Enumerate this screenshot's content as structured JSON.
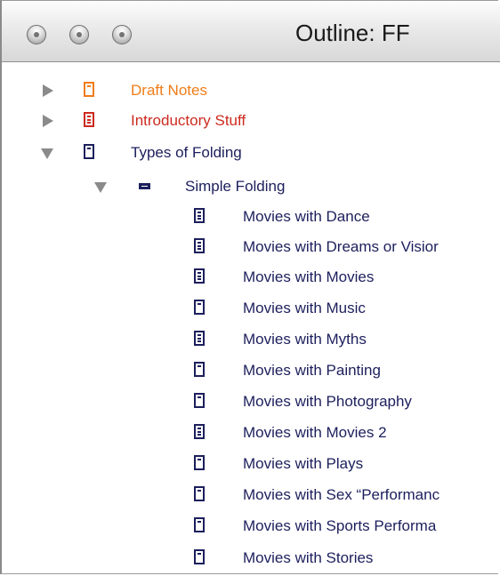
{
  "window": {
    "title": "Outline: FF",
    "controls": [
      "close",
      "minimize",
      "zoom"
    ]
  },
  "colors": {
    "orange": "#f07c18",
    "red": "#cc2b1f",
    "navy": "#1c1f5c",
    "disclosure": "#8a8a8a"
  },
  "outline": {
    "items": [
      {
        "label": "Draft Notes",
        "expanded": false,
        "color": "orange",
        "icon": "document-blank-icon"
      },
      {
        "label": "Introductory Stuff",
        "expanded": false,
        "color": "red",
        "icon": "document-lined-icon"
      },
      {
        "label": "Types of Folding",
        "expanded": true,
        "color": "navy",
        "icon": "document-blank-icon"
      },
      {
        "label": "Simple Folding",
        "expanded": true,
        "color": "navy",
        "icon": "folder-collapsed-icon"
      },
      {
        "label": "Movies with Dance",
        "color": "navy",
        "icon": "document-lined-icon"
      },
      {
        "label": "Movies with Dreams or Visior",
        "color": "navy",
        "icon": "document-lined-icon"
      },
      {
        "label": "Movies with Movies",
        "color": "navy",
        "icon": "document-lined-icon"
      },
      {
        "label": "Movies with Music",
        "color": "navy",
        "icon": "document-blank-icon"
      },
      {
        "label": "Movies with Myths",
        "color": "navy",
        "icon": "document-lined-icon"
      },
      {
        "label": "Movies with Painting",
        "color": "navy",
        "icon": "document-blank-icon"
      },
      {
        "label": "Movies with Photography",
        "color": "navy",
        "icon": "document-blank-icon"
      },
      {
        "label": "Movies with Movies 2",
        "color": "navy",
        "icon": "document-lined-icon"
      },
      {
        "label": "Movies with Plays",
        "color": "navy",
        "icon": "document-blank-icon"
      },
      {
        "label": "Movies with Sex “Performanc",
        "color": "navy",
        "icon": "document-blank-icon"
      },
      {
        "label": "Movies with Sports Performa",
        "color": "navy",
        "icon": "document-blank-icon"
      },
      {
        "label": "Movies with Stories",
        "color": "navy",
        "icon": "document-blank-icon"
      }
    ]
  }
}
